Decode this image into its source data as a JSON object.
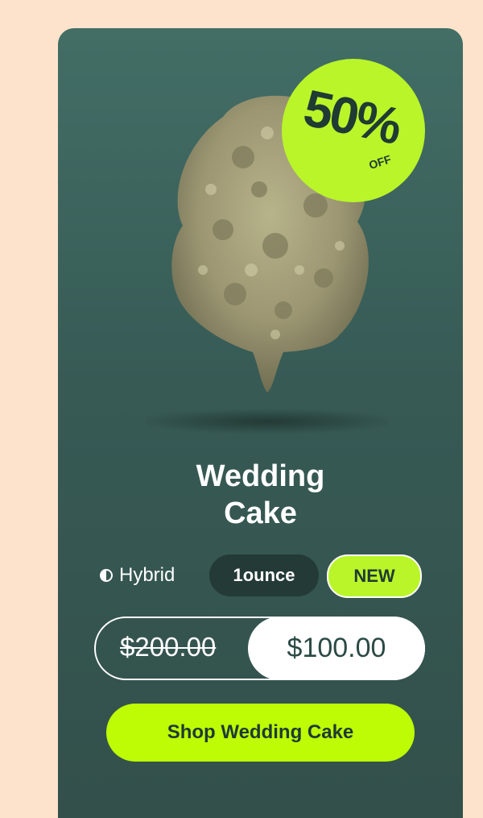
{
  "product": {
    "name_line1": "Wedding",
    "name_line2": "Cake",
    "image": "cannabis-bud-image"
  },
  "badge": {
    "percent": "50%",
    "off": "OFF",
    "color": "#b9f529"
  },
  "meta": {
    "strain": "Hybrid",
    "strain_icon": "half-circle-icon",
    "unit": "1ounce",
    "tag": "NEW"
  },
  "price": {
    "original": "$200.00",
    "sale": "$100.00"
  },
  "cta": {
    "label": "Shop Wedding Cake",
    "color": "#bdfc04"
  },
  "colors": {
    "background": "#fde3cb",
    "card": "#3b5e58",
    "dark_pill": "#233a36"
  }
}
